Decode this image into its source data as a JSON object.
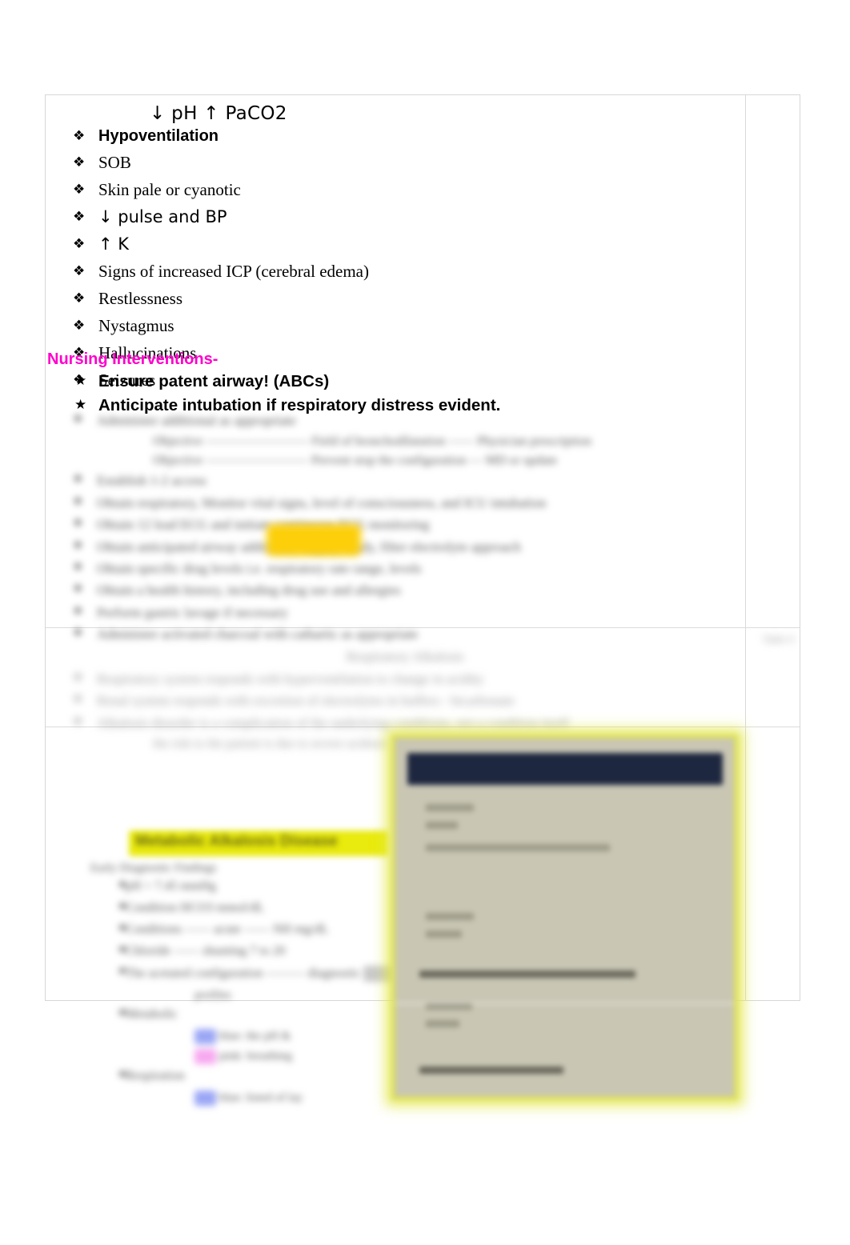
{
  "document": {
    "header_line": "↓ pH ↑ PaCO2",
    "assessment_bullets": [
      {
        "bullet": "❖",
        "text": "Hypoventilation",
        "style": "bold"
      },
      {
        "bullet": "❖",
        "text": "SOB",
        "style": "serif"
      },
      {
        "bullet": "❖",
        "text": "Skin pale or cyanotic",
        "style": "serif"
      },
      {
        "bullet": "❖",
        "text": "↓ pulse and BP",
        "style": "sans"
      },
      {
        "bullet": "❖",
        "text": "↑ K",
        "style": "sans"
      },
      {
        "bullet": "❖",
        "text": "Signs of increased ICP (cerebral edema)",
        "style": "serif"
      },
      {
        "bullet": "❖",
        "text": "Restlessness",
        "style": "serif"
      },
      {
        "bullet": "❖",
        "text": "Nystagmus",
        "style": "serif"
      },
      {
        "bullet": "❖",
        "text": "Hallucinations",
        "style": "serif"
      },
      {
        "bullet": "❖",
        "text": "Seizures",
        "style": "serif"
      }
    ],
    "interventions_heading": "Nursing Interventions-",
    "interventions_heading_color": "#ff00cc",
    "interventions_bullets": [
      {
        "bullet": "★",
        "text": "Ensure patent airway! (ABCs)"
      },
      {
        "bullet": "★",
        "text": "Anticipate intubation if respiratory distress evident."
      }
    ],
    "redacted_block_1": {
      "note": "blurred-illegible",
      "lines": [
        {
          "bullet": "❖",
          "text": "Administer additional as appropriate"
        },
        {
          "bullet": "",
          "text": "Objective ———————— Field of bronchodilatation ——  Physician prescription",
          "indent": true
        },
        {
          "bullet": "",
          "text": "Objective ———————— Prevent stop the configuration —  MD or update",
          "indent": true
        },
        {
          "bullet": "❖",
          "text": "Establish 1-2  access"
        },
        {
          "bullet": "❖",
          "text": "Obtain respiratory, Monitor vital signs, level of consciousness, and ICU intubation"
        },
        {
          "bullet": "❖",
          "text": "Obtain 12 lead ECG and initiate continuous ECG monitoring"
        },
        {
          "bullet": "❖",
          "text": "Obtain anticipated airway additional, supply, ready, filter electrolyte approach"
        },
        {
          "bullet": "❖",
          "text": "Obtain specific drug levels i.e. respiratory rate range, levels"
        },
        {
          "bullet": "❖",
          "text": "Obtain a health history, including drug use and allergies"
        },
        {
          "bullet": "❖",
          "text": "Perform gastric lavage if necessary"
        },
        {
          "bullet": "❖",
          "text": "Administer activated charcoal with cathartic as appropriate"
        }
      ]
    },
    "redacted_block_2": {
      "note": "blurred-illegible",
      "heading": "Respiratory Alkalosis",
      "lines": [
        {
          "bullet": "❖",
          "text": "Respiratory system responds with hyperventilation to change in acidity"
        },
        {
          "bullet": "❖",
          "text": "Renal system responds with excretion of electrolytes in buffers - bicarbonate"
        },
        {
          "bullet": "❖",
          "text": "Alkalosis disorder is a complication of the underlying conditions, not a condition itself"
        },
        {
          "bullet": "",
          "text": "the risk to the patient is due to severe acidosis",
          "indent": true
        }
      ]
    },
    "right_column_text": "Table 4",
    "bottom_title_highlighted": "Metabolic Alkalosis Disease",
    "redacted_block_3": {
      "note": "blurred-illegible",
      "heading": "Early Diagnostic Findings",
      "lines": [
        {
          "bullet": "❖",
          "text": "pH > 7.45 mmHg"
        },
        {
          "bullet": "❖",
          "text": "Condition  HCO3 mmol/dL"
        },
        {
          "bullet": "❖",
          "text": "Conditions ——  acute ——  NH mg/dL"
        },
        {
          "bullet": "❖",
          "text": "Chloride ——  shunting  7 to 20"
        },
        {
          "bullet": "❖",
          "text": "The acetated configuration ———  diagnostic"
        },
        {
          "bullet": "",
          "text": "profiles",
          "indent": true
        },
        {
          "bullet": "❖",
          "text": "Metabolic"
        },
        {
          "bullet": "",
          "text": "blue: the pH &",
          "indent": true,
          "chip": "blue"
        },
        {
          "bullet": "",
          "text": "pink: breathing",
          "indent": true,
          "chip": "pink"
        },
        {
          "bullet": "❖",
          "text": "Respiration"
        },
        {
          "bullet": "",
          "text": "blue: listed of lay",
          "indent": true,
          "chip": "blue"
        }
      ]
    },
    "embedded_image": {
      "note": "blurred embedded screenshot",
      "header_color": "#1e2740",
      "body_color": "#c9c6b4",
      "glow_color": "#dde05f"
    }
  }
}
